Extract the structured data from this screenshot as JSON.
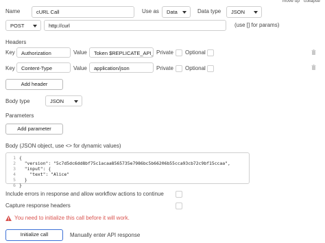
{
  "header": {
    "move_up": "move up",
    "collapse": "collapse"
  },
  "call": {
    "name_label": "Name",
    "name_value": "cURL Call",
    "use_as_label": "Use as",
    "use_as_value": "Data",
    "data_type_label": "Data type",
    "data_type_value": "JSON",
    "method_value": "POST",
    "url_value": "http://curl",
    "url_hint": "(use [] for params)"
  },
  "headers": {
    "section_label": "Headers",
    "key_label": "Key",
    "value_label": "Value",
    "private_label": "Private",
    "optional_label": "Optional",
    "rows": [
      {
        "key": "Authorization",
        "value": "Token $REPLICATE_API_T"
      },
      {
        "key": "Content-Type",
        "value": "application/json"
      }
    ],
    "add_button": "Add header"
  },
  "body_type": {
    "label": "Body type",
    "value": "JSON"
  },
  "parameters": {
    "label": "Parameters",
    "add_button": "Add parameter"
  },
  "body": {
    "label": "Body (JSON object, use <> for dynamic values)",
    "line_numbers": [
      "1",
      "2",
      "3",
      "4",
      "5",
      "6"
    ],
    "code_lines": [
      "{",
      "  \"version\": \"5c7d5dc6dd8bf75c1acaa8565735e7986bc5b66206b55cca93cb72c9bf15ccaa\",",
      "  \"input\": {",
      "    \"text\": \"Alice\"",
      "  }",
      "}"
    ]
  },
  "options": {
    "include_errors": "Include errors in response and allow workflow actions to continue",
    "capture_headers": "Capture response headers"
  },
  "warning": {
    "text": "You need to initialize this call before it will work.",
    "color": "#d9534f"
  },
  "footer": {
    "initialize_button": "Initialize call",
    "manual_button": "Manually enter API response",
    "accent": "#3b6fd6"
  }
}
